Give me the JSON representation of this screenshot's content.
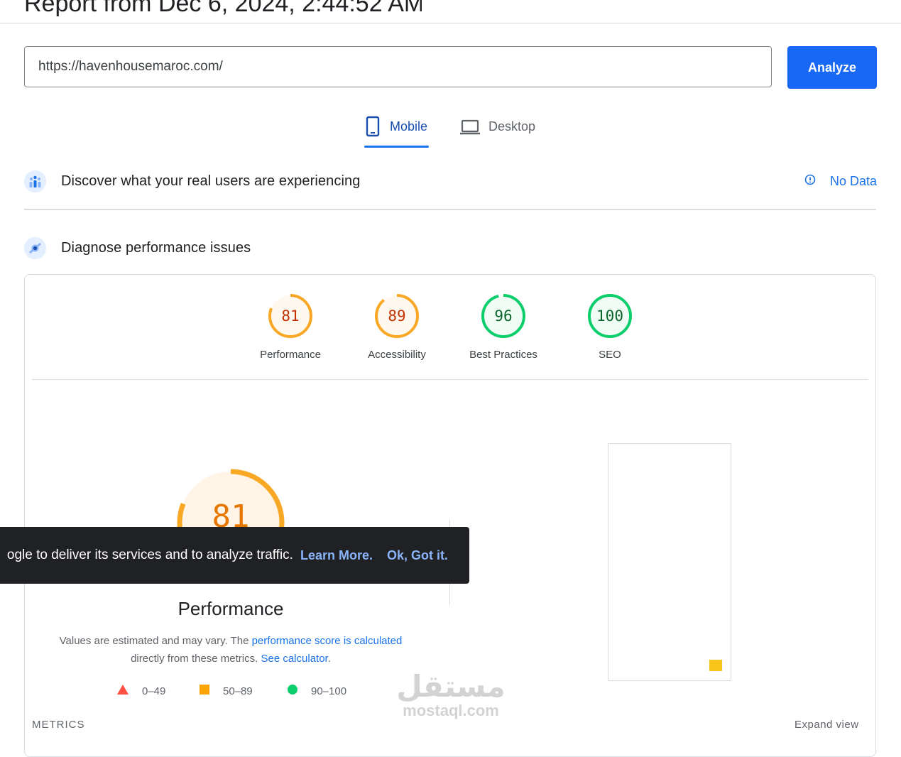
{
  "header": {
    "report_title": "Report from Dec 6, 2024, 2:44:52 AM"
  },
  "search": {
    "url_value": "https://havenhousemaroc.com/",
    "analyze_label": "Analyze"
  },
  "tabs": [
    {
      "label": "Mobile",
      "icon": "smartphone-icon",
      "active": true
    },
    {
      "label": "Desktop",
      "icon": "laptop-icon",
      "active": false
    }
  ],
  "crux": {
    "title": "Discover what your real users are experiencing",
    "status_label": "No Data",
    "status_icon": "info-icon"
  },
  "diagnose": {
    "title": "Diagnose performance issues"
  },
  "scores": [
    {
      "label": "Performance",
      "value": "81",
      "color": "#e67700",
      "ring": "#f9a825"
    },
    {
      "label": "Accessibility",
      "value": "89",
      "color": "#c33300",
      "ring": "#f9a825"
    },
    {
      "label": "Best Practices",
      "value": "96",
      "color": "#0d652d",
      "ring": "#0cce6b"
    },
    {
      "label": "SEO",
      "value": "100",
      "color": "#0d652d",
      "ring": "#0cce6b"
    }
  ],
  "performance": {
    "score": "81",
    "title": "Performance",
    "desc_prefix": "Values are estimated and may vary. The ",
    "desc_link1": "performance score is calculated",
    "desc_middle": "directly from these metrics. ",
    "desc_link2": "See calculator",
    "desc_suffix": "."
  },
  "legend": [
    {
      "range": "0–49",
      "shape": "triangle",
      "color": "#ff4e42"
    },
    {
      "range": "50–89",
      "shape": "square",
      "color": "#ffa400"
    },
    {
      "range": "90–100",
      "shape": "circle",
      "color": "#0cce6b"
    }
  ],
  "footer": {
    "metrics_label": "METRICS",
    "expand_label": "Expand view"
  },
  "toast": {
    "message": "ogle to deliver its services and to analyze traffic.",
    "learn_more": "Learn More.",
    "ok": "Ok, Got it."
  },
  "watermark": {
    "arabic": "مستقل",
    "latin": "mostaql.com"
  }
}
